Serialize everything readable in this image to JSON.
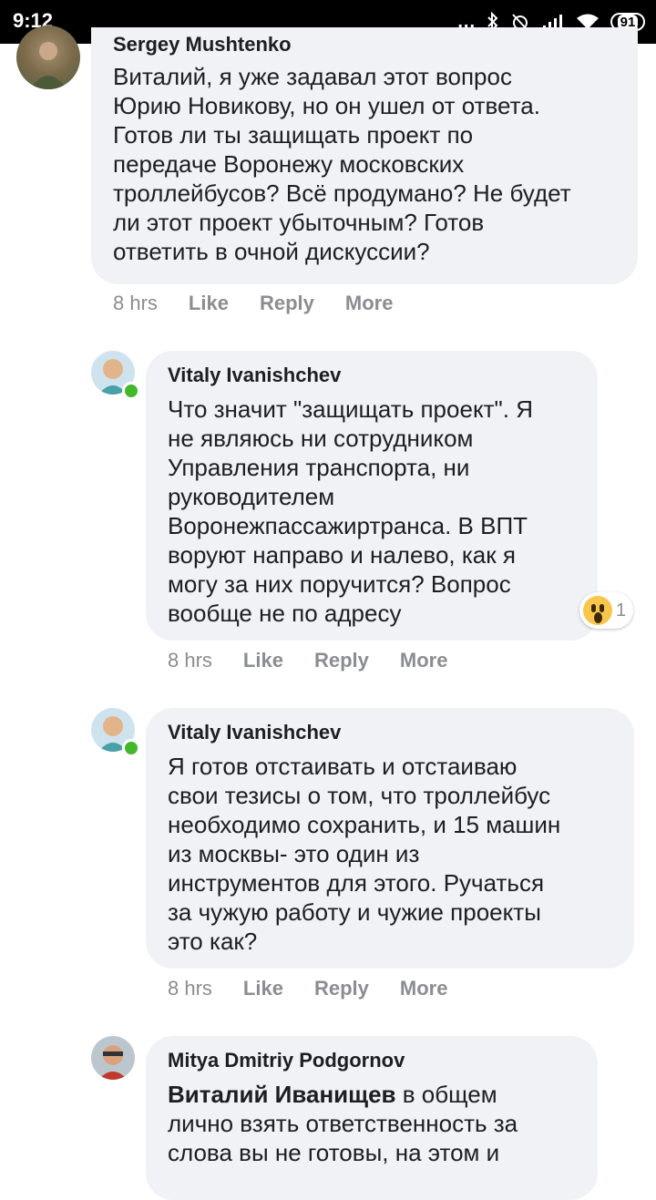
{
  "status_bar": {
    "time": "9:12",
    "dots": "...",
    "battery": "91"
  },
  "comments": [
    {
      "author": "Sergey Mushtenko",
      "text": "Виталий, я уже задавал этот вопрос\nЮрию Новикову, но он ушел от ответа.\nГотов ли ты защищать проект по\nпередаче Воронежу московских\nтроллейбусов? Всё продумано? Не будет\nли этот проект убыточным? Готов\nответить в очной дискуссии?",
      "time": "8 hrs",
      "like": "Like",
      "reply": "Reply",
      "more": "More"
    },
    {
      "author": "Vitaly Ivanishchev",
      "text": "Что значит \"защищать проект\". Я\nне являюсь ни сотрудником\nУправления транспорта, ни\nруководителем\nВоронежпассажиртранса. В ВПТ\nворуют направо и налево, как я\nмогу за них поручится? Вопрос\nвообще не по адресу",
      "reaction_count": "1",
      "time": "8 hrs",
      "like": "Like",
      "reply": "Reply",
      "more": "More"
    },
    {
      "author": "Vitaly Ivanishchev",
      "text": "Я готов отстаивать и отстаиваю\nсвои тезисы о том, что троллейбус\nнеобходимо сохранить, и 15 машин\nиз москвы- это один из\nинструментов для этого. Ручаться\nза чужую работу и чужие проекты\nэто как?",
      "time": "8 hrs",
      "like": "Like",
      "reply": "Reply",
      "more": "More"
    },
    {
      "author": "Mitya Dmitriy Podgornov",
      "mention": "Виталий Иванищев",
      "text": " в общем\nлично взять ответственность за\nслова вы не готовы, на этом и"
    }
  ],
  "colors": {
    "bubble": "#f0f2f5",
    "online": "#42b72a",
    "meta": "#8a8d91"
  }
}
